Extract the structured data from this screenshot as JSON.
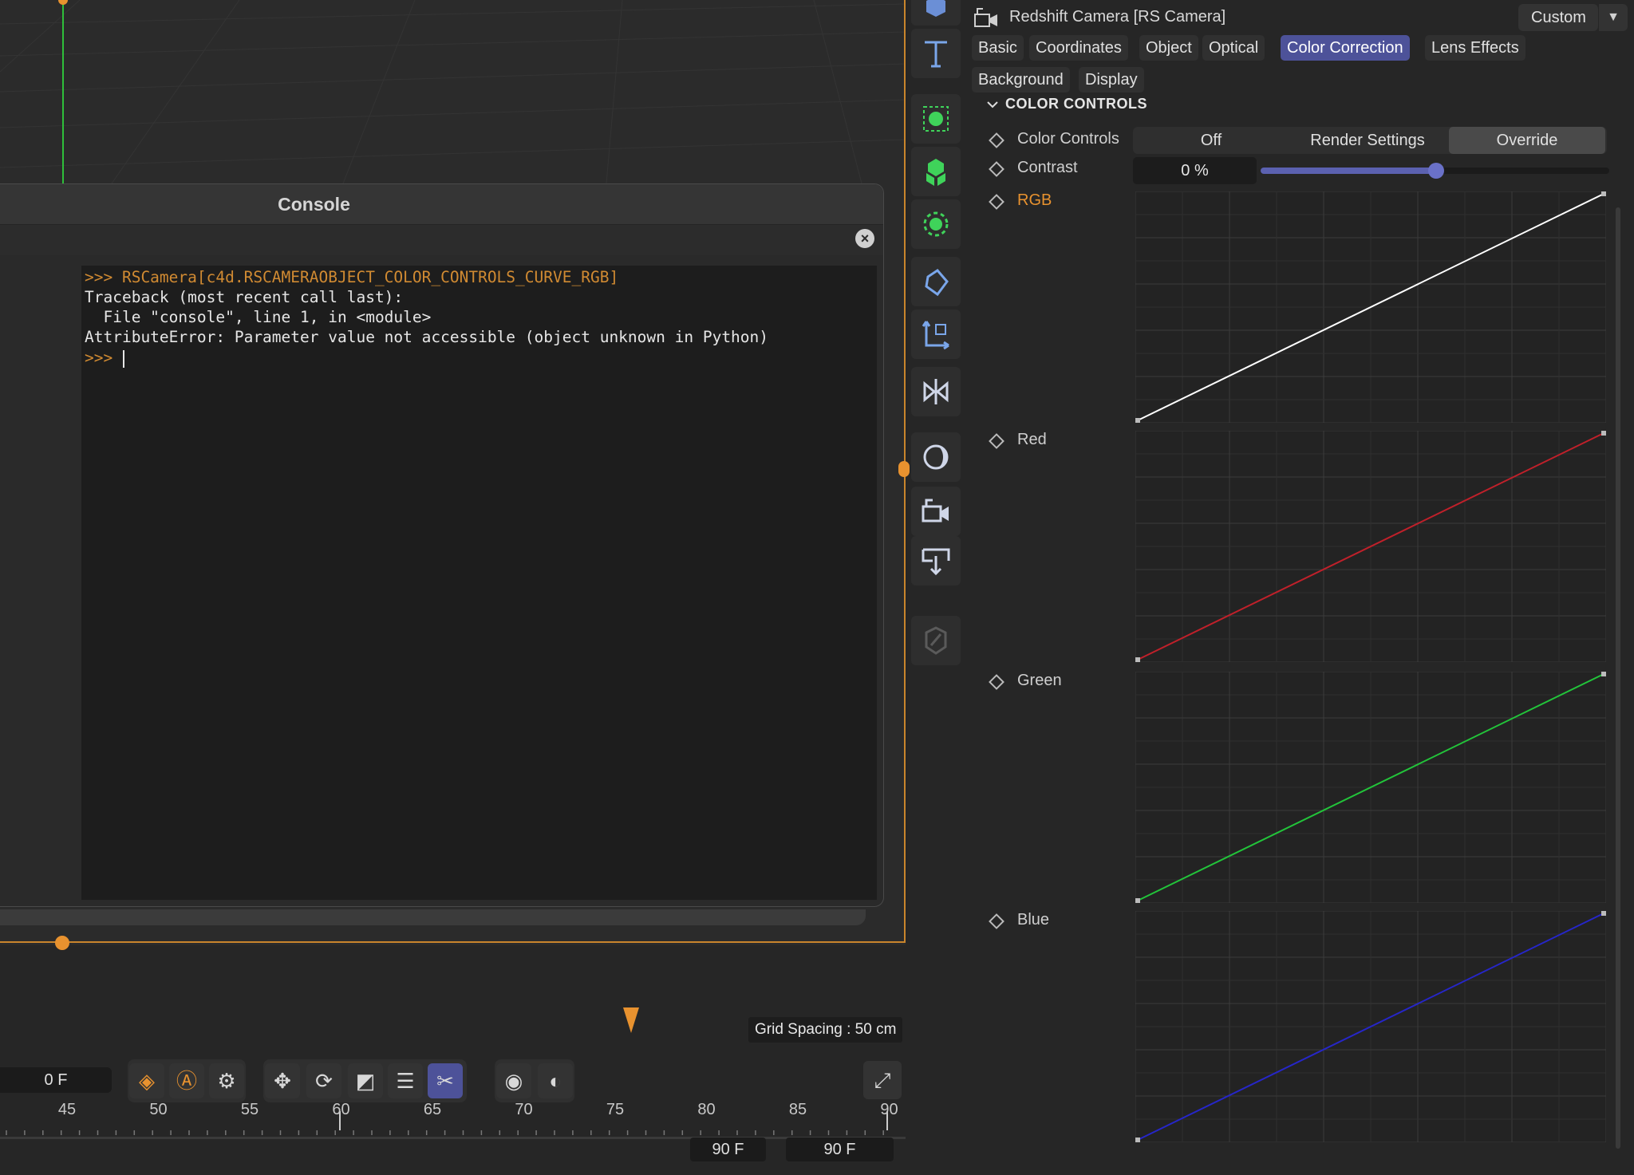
{
  "viewport": {
    "grid_spacing": "Grid Spacing : 50 cm"
  },
  "console": {
    "title": "Console",
    "close_icon": "close-icon",
    "lines": {
      "command": ">>> RSCamera[c4d.RSCAMERAOBJECT_COLOR_CONTROLS_CURVE_RGB]",
      "traceback_1": "Traceback (most recent call last):",
      "traceback_2": "  File \"console\", line 1, in <module>",
      "traceback_3": "AttributeError: Parameter value not accessible (object unknown in Python)",
      "prompt": ">>> "
    }
  },
  "timeline": {
    "current_frame": "0 F",
    "ruler_labels": [
      "45",
      "50",
      "55",
      "60",
      "65",
      "70",
      "75",
      "80",
      "85",
      "90"
    ],
    "end_frame_a": "90 F",
    "end_frame_b": "90 F",
    "buttons": [
      "record-keyframe-icon",
      "autokey-icon",
      "keyframe-settings-icon",
      "position-key-icon",
      "rotation-key-icon",
      "scale-key-icon",
      "parameter-key-icon",
      "pla-key-icon",
      "motion-record-icon",
      "motion-settings-icon",
      "interactive-render-icon"
    ]
  },
  "attributes": {
    "title": "Redshift Camera [RS Camera]",
    "mode": "Custom",
    "tabs": [
      "Basic",
      "Coordinates",
      "Object",
      "Optical",
      "Color Correction",
      "Lens Effects",
      "Background",
      "Display"
    ],
    "active_tab": "Color Correction",
    "section": "COLOR CONTROLS",
    "color_controls": {
      "label": "Color Controls",
      "options": [
        "Off",
        "Render Settings",
        "Override"
      ],
      "selected": "Override"
    },
    "contrast": {
      "label": "Contrast",
      "value": "0 %",
      "slider_level": 0.5
    },
    "curves": [
      {
        "label": "RGB",
        "color": "#ffffff",
        "label_color": "#e8922f"
      },
      {
        "label": "Red",
        "color": "#c0202a",
        "label_color": "#cfcfcf"
      },
      {
        "label": "Green",
        "color": "#22c43a",
        "label_color": "#cfcfcf"
      },
      {
        "label": "Blue",
        "color": "#2626c8",
        "label_color": "#cfcfcf"
      }
    ]
  },
  "colors": {
    "accent_orange": "#e8922f",
    "active_tab": "#4d5299",
    "axis_green": "#2fbf3a"
  }
}
